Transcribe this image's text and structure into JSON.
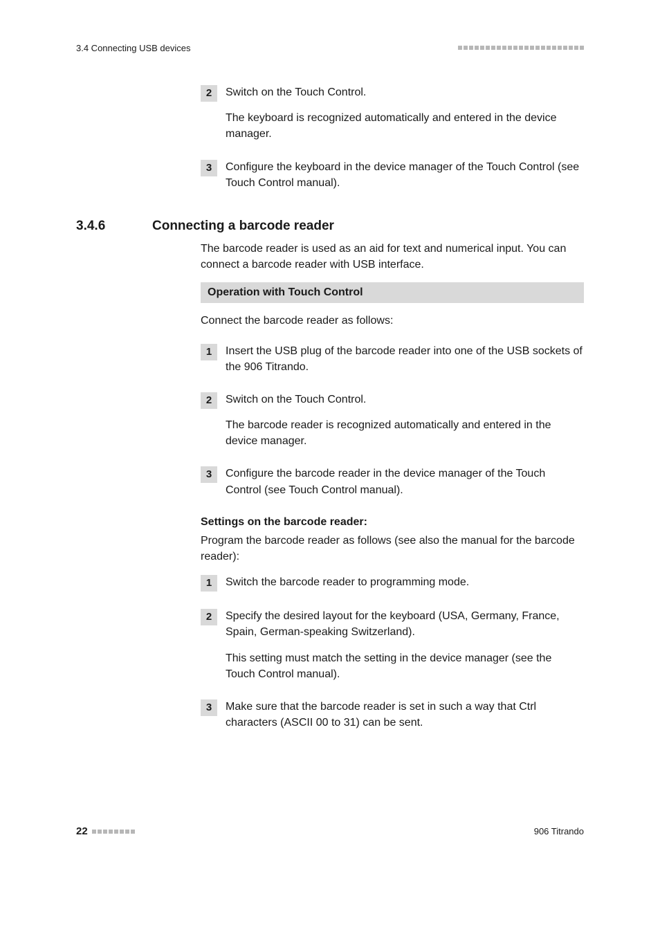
{
  "header": {
    "section_label": "3.4 Connecting USB devices"
  },
  "footer": {
    "page_number": "22",
    "product": "906 Titrando"
  },
  "intro_steps": [
    {
      "num": "2",
      "lines": [
        "Switch on the Touch Control.",
        "The keyboard is recognized automatically and entered in the device manager."
      ]
    },
    {
      "num": "3",
      "lines": [
        "Configure the keyboard in the device manager of the Touch Control (see Touch Control manual)."
      ]
    }
  ],
  "section": {
    "number": "3.4.6",
    "title": "Connecting a barcode reader",
    "intro": "The barcode reader is used as an aid for text and numerical input. You can connect a barcode reader with USB interface.",
    "band_title": "Operation with Touch Control",
    "band_after": "Connect the barcode reader as follows:",
    "steps_a": [
      {
        "num": "1",
        "lines": [
          "Insert the USB plug of the barcode reader into one of the USB sockets of the 906 Titrando."
        ]
      },
      {
        "num": "2",
        "lines": [
          "Switch on the Touch Control.",
          "The barcode reader is recognized automatically and entered in the device manager."
        ]
      },
      {
        "num": "3",
        "lines": [
          "Configure the barcode reader in the device manager of the Touch Control (see Touch Control manual)."
        ]
      }
    ],
    "subhead": "Settings on the barcode reader:",
    "subhead_after": "Program the barcode reader as follows (see also the manual for the barcode reader):",
    "steps_b": [
      {
        "num": "1",
        "lines": [
          "Switch the barcode reader to programming mode."
        ]
      },
      {
        "num": "2",
        "lines": [
          "Specify the desired layout for the keyboard (USA, Germany, France, Spain, German-speaking Switzerland).",
          "This setting must match the setting in the device manager (see the Touch Control manual)."
        ]
      },
      {
        "num": "3",
        "lines": [
          "Make sure that the barcode reader is set in such a way that Ctrl characters (ASCII 00 to 31) can be sent."
        ]
      }
    ]
  }
}
